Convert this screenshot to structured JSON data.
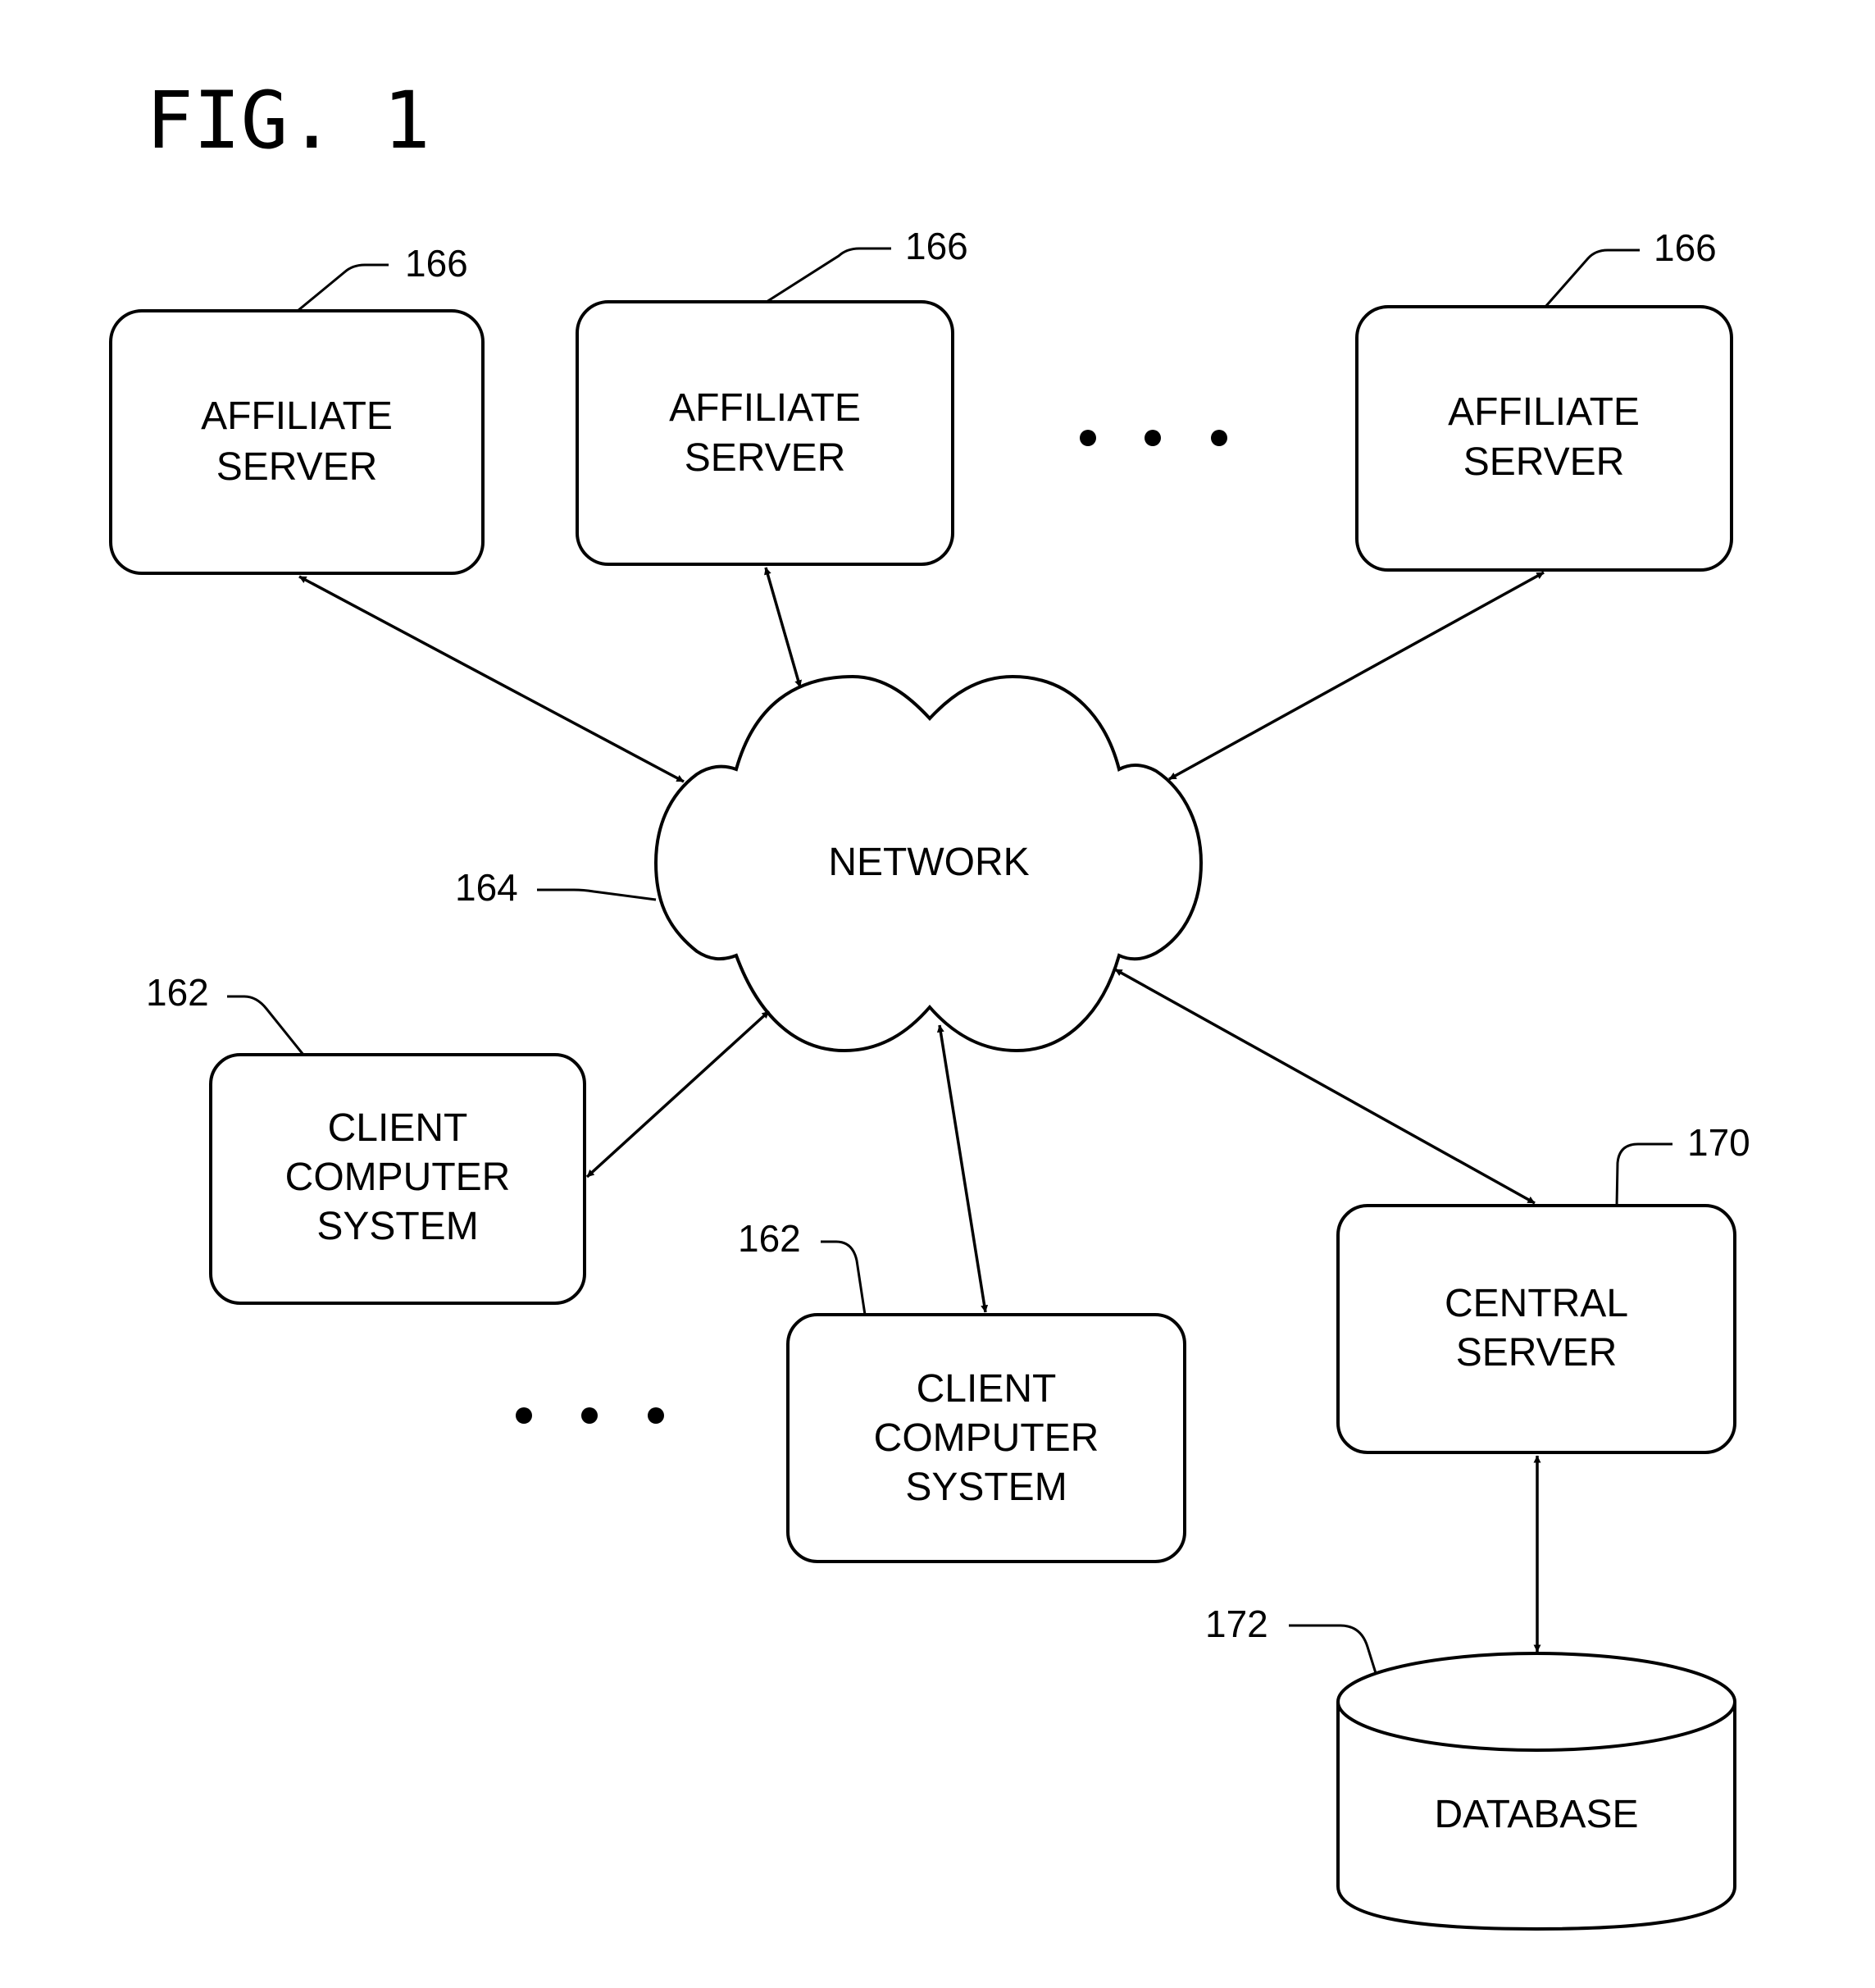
{
  "figure": {
    "title": "FIG. 1"
  },
  "nodes": {
    "affiliate_1": {
      "lines": [
        "AFFILIATE",
        "SERVER"
      ],
      "ref": "166"
    },
    "affiliate_2": {
      "lines": [
        "AFFILIATE",
        "SERVER"
      ],
      "ref": "166"
    },
    "affiliate_3": {
      "lines": [
        "AFFILIATE",
        "SERVER"
      ],
      "ref": "166"
    },
    "network": {
      "lines": [
        "NETWORK"
      ],
      "ref": "164"
    },
    "client_1": {
      "lines": [
        "CLIENT",
        "COMPUTER",
        "SYSTEM"
      ],
      "ref": "162"
    },
    "client_2": {
      "lines": [
        "CLIENT",
        "COMPUTER",
        "SYSTEM"
      ],
      "ref": "162"
    },
    "central": {
      "lines": [
        "CENTRAL",
        "SERVER"
      ],
      "ref": "170"
    },
    "database": {
      "lines": [
        "DATABASE"
      ],
      "ref": "172"
    }
  },
  "edges": [
    {
      "from": "affiliate_1",
      "to": "network",
      "type": "bidirectional"
    },
    {
      "from": "affiliate_2",
      "to": "network",
      "type": "bidirectional"
    },
    {
      "from": "affiliate_3",
      "to": "network",
      "type": "bidirectional"
    },
    {
      "from": "client_1",
      "to": "network",
      "type": "bidirectional"
    },
    {
      "from": "client_2",
      "to": "network",
      "type": "bidirectional"
    },
    {
      "from": "central",
      "to": "network",
      "type": "bidirectional"
    },
    {
      "from": "central",
      "to": "database",
      "type": "bidirectional"
    }
  ],
  "ellipsis": {
    "affiliates": "more affiliate servers",
    "clients": "more client computer systems"
  }
}
